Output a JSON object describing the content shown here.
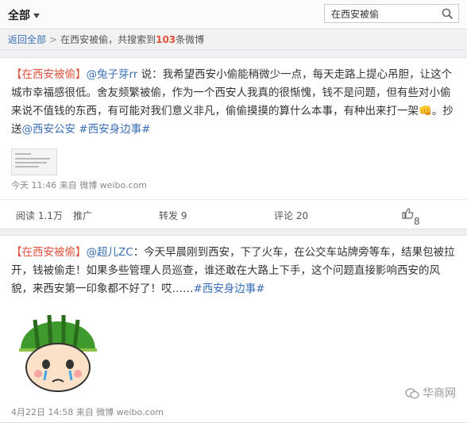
{
  "header": {
    "filter_label": "全部",
    "search_value": "在西安被偷"
  },
  "breadcrumb": {
    "back_label": "返回全部",
    "sep": ">",
    "query": "在西安被偷",
    "result_prefix": "，共搜索到",
    "result_count": "103",
    "result_suffix": "条微博"
  },
  "posts": [
    {
      "keyword": "【在西安被偷】",
      "author": "@兔子芽rr",
      "text": " 说：我希望西安小偷能稍微少一点，每天走路上提心吊胆，让这个城市幸福感很低。舍友频繁被偷，作为一个西安人我真的很惭愧，钱不是问题，但有些对小偷来说不值钱的东西，有可能对我们意义非凡，偷偷摸摸的算什么本事，有种出来打一架",
      "emoji": "👊",
      "cc_prefix": "。抄送",
      "cc": "@西安公安",
      "tag": " #西安身边事#",
      "meta": "今天 11:46 来自 微博 weibo.com",
      "read": "阅读 1.1万",
      "promote": "推广",
      "repost": "转发 9",
      "comment": "评论 20",
      "likes": "8"
    },
    {
      "keyword": "【在西安被偷】",
      "author": "@超儿ZC",
      "text": "：今天早晨刚到西安，下了火车，在公交车站牌旁等车，结果包被拉开，钱被偷走！如果多些管理人员巡查，谁还敢在大路上下手，这个问题直接影响西安的风貌，来西安第一印象都不好了！哎……",
      "tag": "#西安身边事#",
      "meta": "4月22日 14:58 来自 微博 weibo.com"
    }
  ],
  "watermark": "华商网"
}
